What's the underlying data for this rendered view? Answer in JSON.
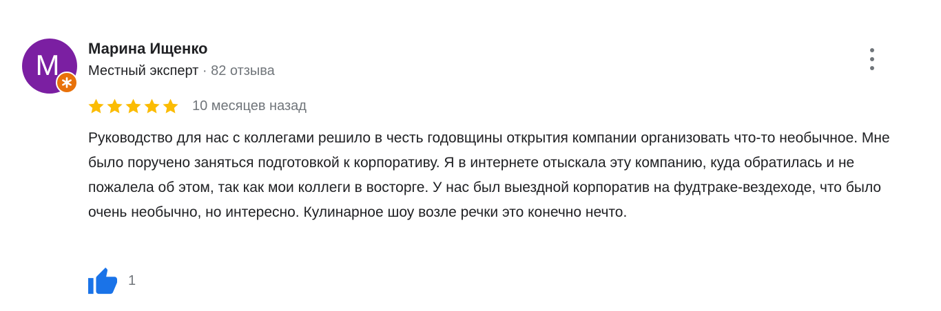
{
  "review": {
    "author": {
      "initial": "M",
      "name": "Марина Ищенко",
      "badge_label": "Местный эксперт",
      "separator": "·",
      "reviews_count": "82 отзыва",
      "avatar_color": "#7b1fa2",
      "badge_color": "#e8710a"
    },
    "rating": {
      "stars": 5,
      "max": 5,
      "star_color": "#fbbc04"
    },
    "date": "10 месяцев назад",
    "text": "Руководство для нас с коллегами решило в честь годовщины открытия компании организовать что-то необычное. Мне было поручено заняться подготовкой к корпоративу. Я в интернете отыскала эту компанию, куда обратилась и не пожалела об этом, так как мои коллеги в восторге. У нас был выездной корпоратив на фудтраке-вездеходе, что было очень необычно, но интересно. Кулинарное шоу возле речки это конечно нечто.",
    "likes": "1",
    "like_icon": "thumbs-up-icon",
    "like_color": "#1a73e8",
    "more_icon": "more-vert-icon"
  }
}
